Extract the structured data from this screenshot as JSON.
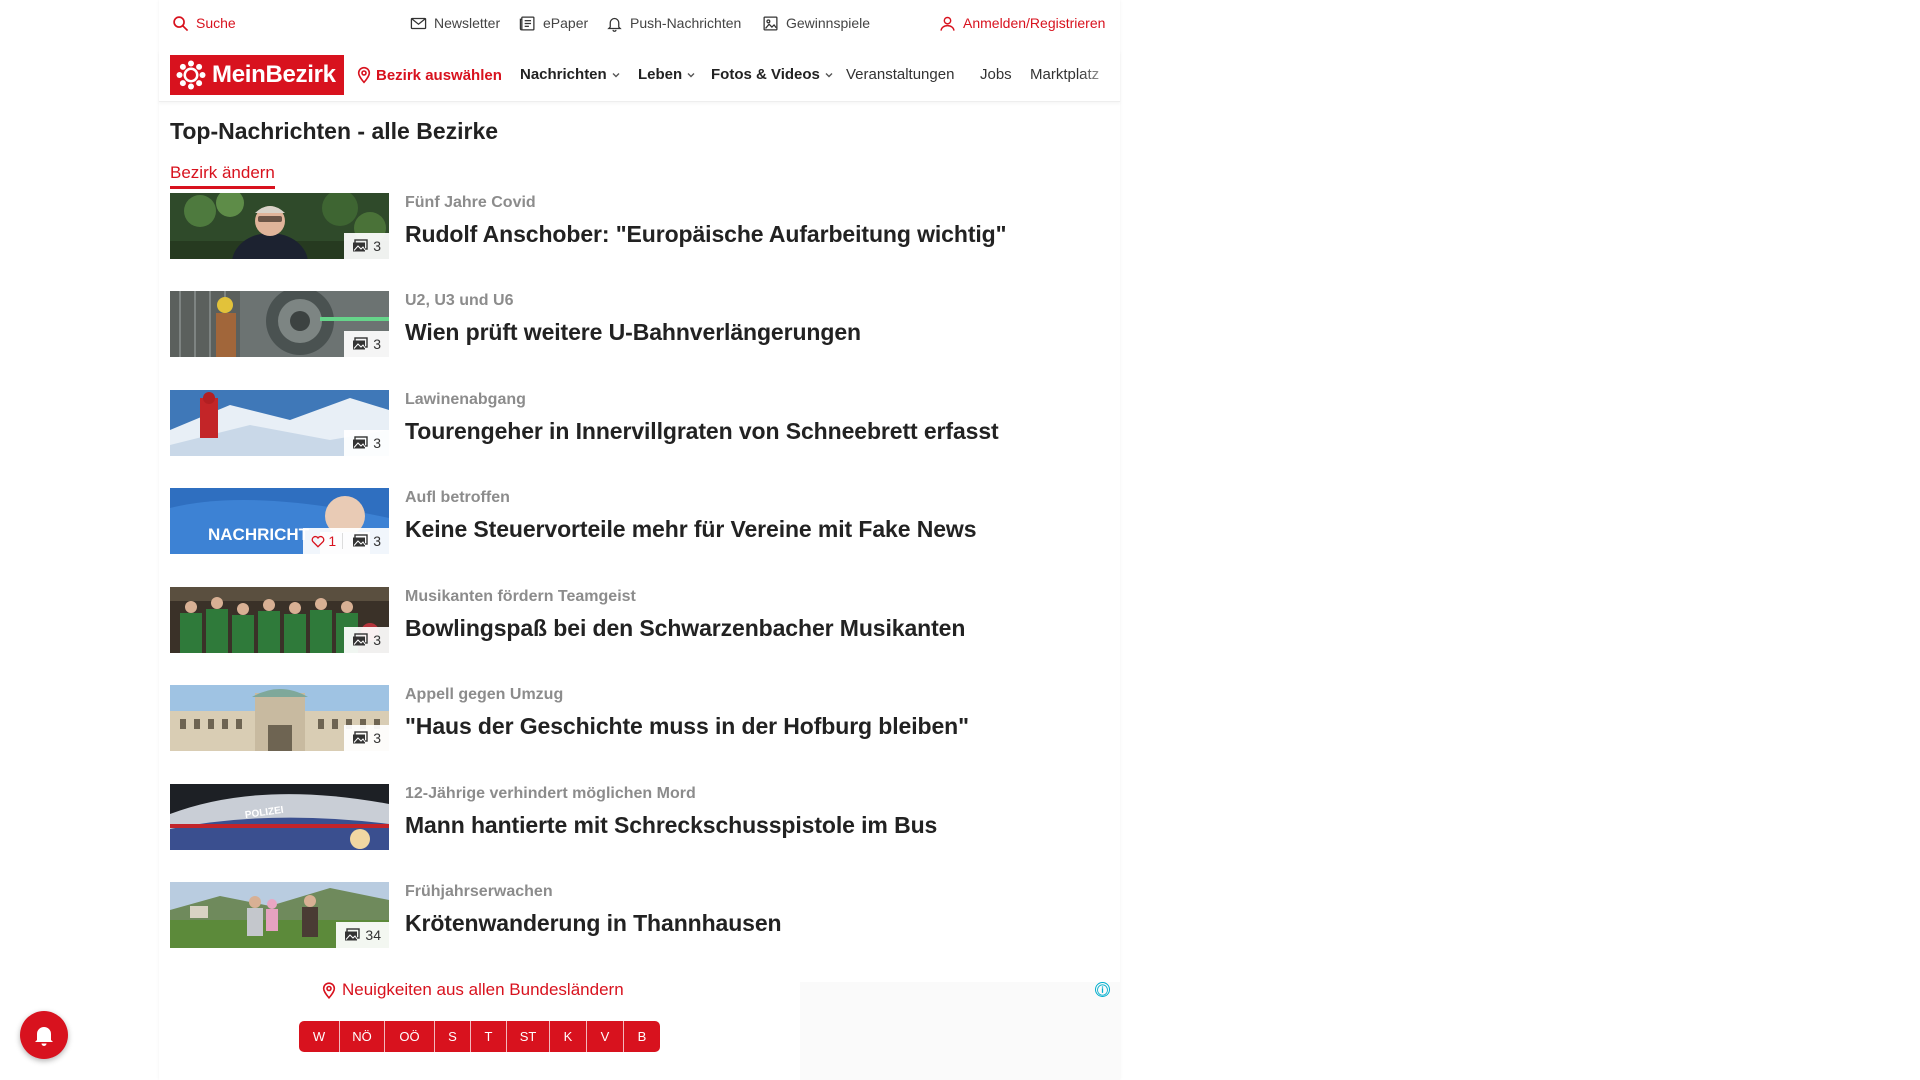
{
  "utility_bar": {
    "search": "Suche",
    "newsletter": "Newsletter",
    "epaper": "ePaper",
    "push": "Push-Nachrichten",
    "contests": "Gewinnspiele",
    "login": "Anmelden/Registrieren"
  },
  "nav": {
    "logo": "MeinBezirk",
    "district_select": "Bezirk auswählen",
    "items": [
      "Nachrichten",
      "Leben",
      "Fotos & Videos",
      "Veranstaltungen",
      "Jobs",
      "Marktplatz"
    ]
  },
  "page": {
    "title": "Top-Nachrichten - alle Bezirke",
    "change_district": "Bezirk ändern"
  },
  "articles": [
    {
      "kicker": "Fünf Jahre Covid",
      "headline": "Rudolf Anschober: \"Europäische Aufarbeitung wichtig\"",
      "images": "3"
    },
    {
      "kicker": "U2, U3 und U6",
      "headline": "Wien prüft weitere U-Bahnverlängerungen",
      "images": "3"
    },
    {
      "kicker": "Lawinenabgang",
      "headline": "Tourengeher in Innervillgraten von Schneebrett erfasst",
      "images": "3"
    },
    {
      "kicker": "Aufl betroffen",
      "headline": "Keine Steuervorteile mehr für Vereine mit Fake News",
      "images": "3",
      "likes": "1",
      "thumb_text": "NACHRICHT"
    },
    {
      "kicker": "Musikanten fördern Teamgeist",
      "headline": "Bowlingspaß bei den Schwarzenbacher Musikanten",
      "images": "3"
    },
    {
      "kicker": "Appell gegen Umzug",
      "headline": "\"Haus der Geschichte muss in der Hofburg bleiben\"",
      "images": "3"
    },
    {
      "kicker": "12-Jährige verhindert möglichen Mord",
      "headline": "Mann hantierte mit Schreckschusspistole im Bus",
      "thumb_text": "POLIZEI"
    },
    {
      "kicker": "Frühjahrserwachen",
      "headline": "Krötenwanderung in Thannhausen",
      "images": "34"
    }
  ],
  "states": {
    "title": "Neuigkeiten aus allen Bundesländern",
    "buttons": [
      "W",
      "NÖ",
      "OÖ",
      "S",
      "T",
      "ST",
      "K",
      "V",
      "B"
    ]
  },
  "ad": {
    "info_icon": "ⓘ"
  },
  "colors": {
    "accent": "#d8121e",
    "kicker": "#8c8c8c",
    "text": "#222222"
  }
}
